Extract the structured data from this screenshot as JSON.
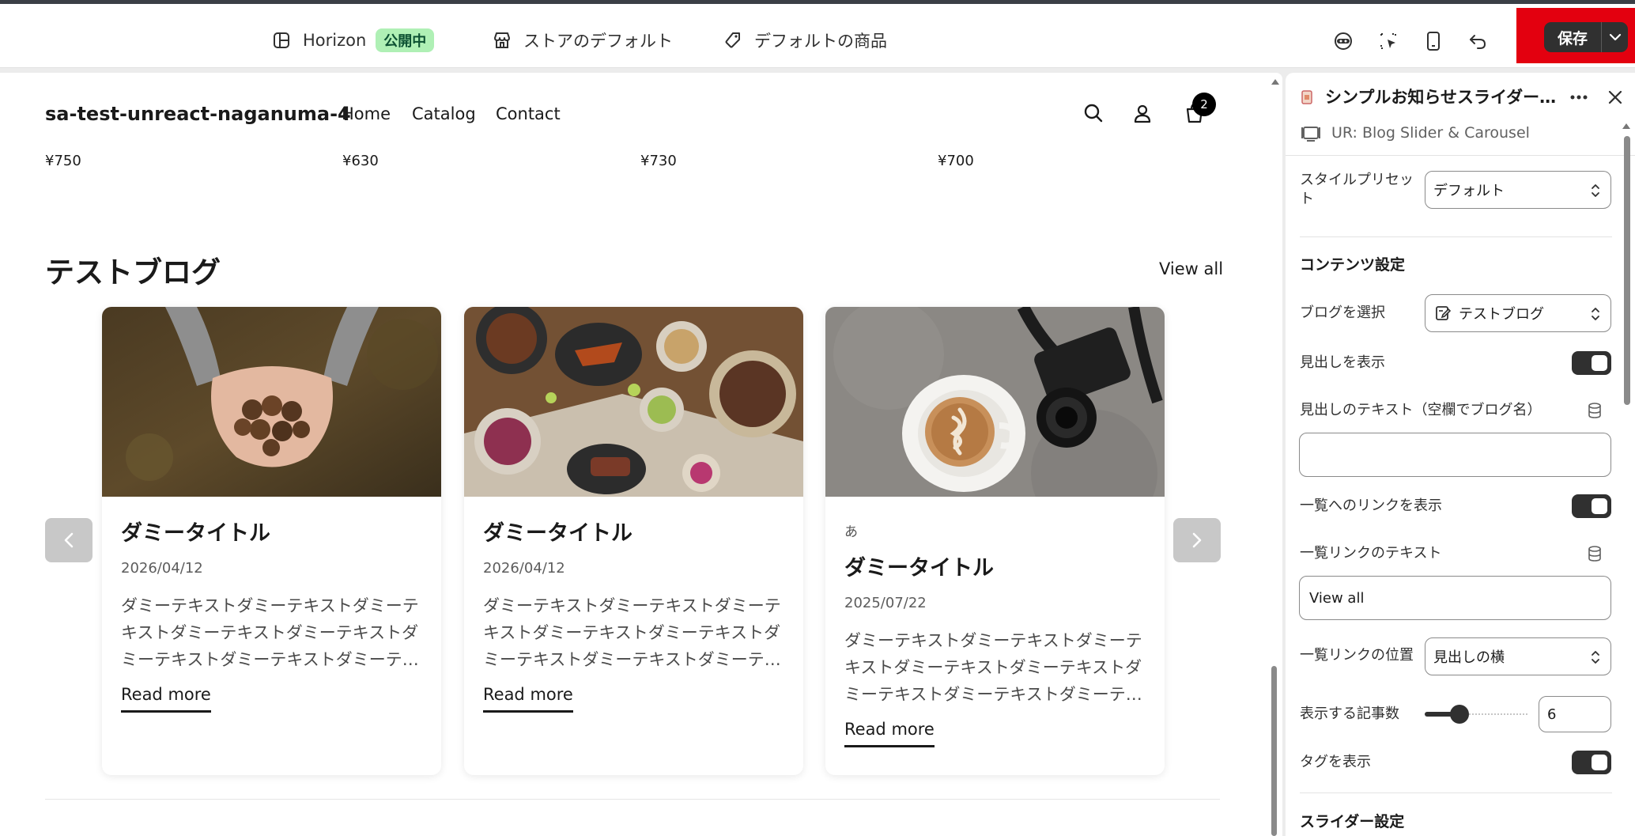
{
  "topbar": {
    "theme_name": "Horizon",
    "theme_status": "公開中",
    "store_default": "ストアのデフォルト",
    "product_default": "デフォルトの商品",
    "save_label": "保存"
  },
  "store": {
    "name": "sa-test-unreact-naganuma-4",
    "nav": [
      "Home",
      "Catalog",
      "Contact"
    ],
    "cart_count": "2",
    "prices": [
      "¥750",
      "¥630",
      "¥730",
      "¥700"
    ]
  },
  "blog_section": {
    "title": "テストブログ",
    "view_all": "View all",
    "cards": [
      {
        "tag": "",
        "title": "ダミータイトル",
        "date": "2026/04/12",
        "excerpt": "ダミーテキストダミーテキストダミーテキストダミーテキストダミーテキストダミーテキストダミーテキストダミーテ…",
        "read_more": "Read more"
      },
      {
        "tag": "",
        "title": "ダミータイトル",
        "date": "2026/04/12",
        "excerpt": "ダミーテキストダミーテキストダミーテキストダミーテキストダミーテキストダミーテキストダミーテキストダミーテ…",
        "read_more": "Read more"
      },
      {
        "tag": "あ",
        "title": "ダミータイトル",
        "date": "2025/07/22",
        "excerpt": "ダミーテキストダミーテキストダミーテキストダミーテキストダミーテキストダミーテキストダミーテキストダミーテ…",
        "read_more": "Read more"
      }
    ]
  },
  "panel": {
    "title": "シンプルお知らせスライダー…",
    "subtitle": "UR: Blog Slider & Carousel",
    "style_preset_label": "スタイルプリセット",
    "style_preset_value": "デフォルト",
    "content_section": "コンテンツ設定",
    "blog_select_label": "ブログを選択",
    "blog_select_value": "テストブログ",
    "show_heading_label": "見出しを表示",
    "heading_text_label": "見出しのテキスト（空欄でブログ名）",
    "heading_text_value": "",
    "show_list_link_label": "一覧へのリンクを表示",
    "list_link_text_label": "一覧リンクのテキスト",
    "list_link_text_value": "View all",
    "list_link_position_label": "一覧リンクの位置",
    "list_link_position_value": "見出しの横",
    "post_count_label": "表示する記事数",
    "post_count_value": "6",
    "show_tags_label": "タグを表示",
    "slider_section": "スライダー設定"
  }
}
